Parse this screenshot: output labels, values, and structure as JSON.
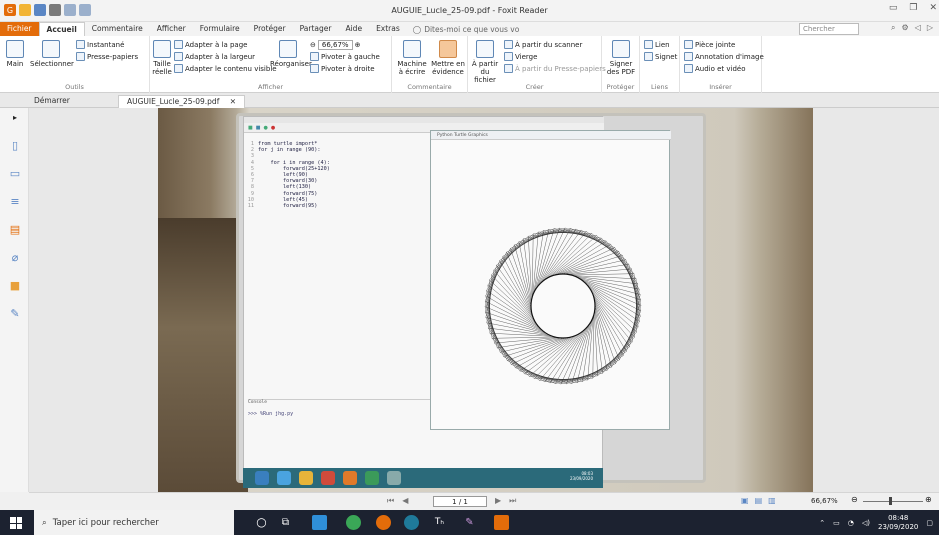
{
  "app": {
    "title": "AUGUIE_Lucle_25-09.pdf - Foxit Reader"
  },
  "menu": {
    "file": "Fichier",
    "tabs": [
      "Accueil",
      "Commentaire",
      "Afficher",
      "Formulaire",
      "Protéger",
      "Partager",
      "Aide",
      "Extras"
    ],
    "tellme": "Dites-moi ce que vous vo",
    "search_placeholder": "Chercher"
  },
  "ribbon": {
    "outils": {
      "label": "Outils",
      "main": "Main",
      "select": "Sélectionner",
      "snapshot": "Instantané",
      "clipboard": "Presse-papiers"
    },
    "afficher": {
      "label": "Afficher",
      "real_size": "Taille réelle",
      "fit_page": "Adapter à la page",
      "fit_width": "Adapter à la largeur",
      "fit_visible": "Adapter le contenu visible",
      "reorganize": "Réorganiser",
      "zoom": "66,67%",
      "rotate_left": "Pivoter à gauche",
      "rotate_right": "Pivoter à droite"
    },
    "commentaire": {
      "label": "Commentaire",
      "typewriter": "Machine à écrire",
      "highlight": "Mettre en évidence"
    },
    "creer": {
      "label": "Créer",
      "from_file": "À partir du fichier",
      "from_scanner": "À partir du scanner",
      "blank": "Vierge",
      "from_clipboard": "À partir du Presse-papiers"
    },
    "proteger": {
      "label": "Protéger",
      "sign": "Signer des PDF"
    },
    "liens": {
      "label": "Liens",
      "link": "Lien",
      "bookmark": "Signet"
    },
    "inserer": {
      "label": "Insérer",
      "attachment": "Pièce jointe",
      "image_annot": "Annotation d'image",
      "audio_video": "Audio et vidéo"
    }
  },
  "doc_tabs": {
    "start": "Démarrer",
    "file": "AUGUIE_Lucle_25-09.pdf"
  },
  "photo": {
    "code_lines": [
      "from turtle import*",
      "for j in range (90):",
      "",
      "    for i in range (4):",
      "        forward(25+120)",
      "        left(90)",
      "        forward(30)",
      "        left(130)",
      "        forward(75)",
      "        left(45)",
      "        forward(95)"
    ],
    "line_numbers": [
      "1",
      "2",
      "3",
      "4",
      "5",
      "6",
      "7",
      "8",
      "9",
      "10",
      "11"
    ],
    "console_label": "Console",
    "console_text": ">>> %Run jhg.py",
    "turtle_title": "Python Turtle Graphics",
    "clock_time": "08:03",
    "clock_date": "23/09/2020"
  },
  "navbar": {
    "page": "1 / 1",
    "zoom": "66,67%"
  },
  "taskbar": {
    "search": "Taper ici pour rechercher",
    "time": "08:48",
    "date": "23/09/2020"
  }
}
